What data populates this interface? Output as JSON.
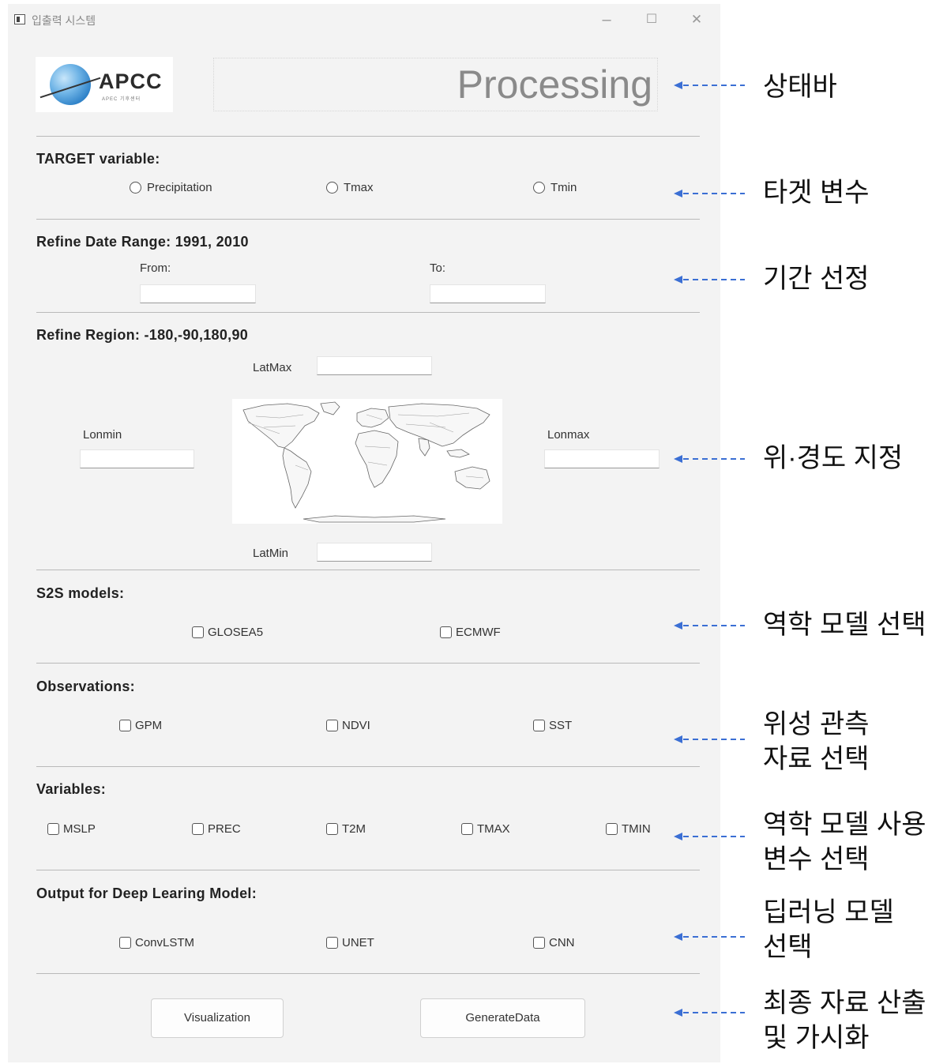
{
  "window": {
    "title": "입출력 시스템",
    "minimize_glyph": "–",
    "maximize_glyph": "☐",
    "close_glyph": "✕"
  },
  "logo": {
    "text": "APCC",
    "subtext": "APEC 기후센터"
  },
  "status_bar": {
    "text": "Processing"
  },
  "target_variable": {
    "title": "TARGET variable:",
    "options": [
      "Precipitation",
      "Tmax",
      "Tmin"
    ]
  },
  "date_range": {
    "title": "Refine Date Range: 1991, 2010",
    "from_label": "From:",
    "to_label": "To:",
    "from_value": "",
    "to_value": ""
  },
  "region": {
    "title": "Refine Region: -180,-90,180,90",
    "latmax_label": "LatMax",
    "latmin_label": "LatMin",
    "lonmin_label": "Lonmin",
    "lonmax_label": "Lonmax",
    "latmax_value": "",
    "latmin_value": "",
    "lonmin_value": "",
    "lonmax_value": ""
  },
  "s2s_models": {
    "title": "S2S models:",
    "options": [
      "GLOSEA5",
      "ECMWF"
    ]
  },
  "observations": {
    "title": "Observations:",
    "options": [
      "GPM",
      "NDVI",
      "SST"
    ]
  },
  "variables": {
    "title": "Variables:",
    "options": [
      "MSLP",
      "PREC",
      "T2M",
      "TMAX",
      "TMIN"
    ]
  },
  "output_model": {
    "title": "Output for Deep Learing Model:",
    "options": [
      "ConvLSTM",
      "UNET",
      "CNN"
    ]
  },
  "buttons": {
    "visualization": "Visualization",
    "generate": "GenerateData"
  },
  "annotations": [
    "상태바",
    "타겟 변수",
    "기간 선정",
    "위·경도 지정",
    "역학 모델 선택",
    "위성 관측\n자료 선택",
    "역학 모델 사용\n변수 선택",
    "딥러닝 모델\n선택",
    "최종 자료 산출\n및 가시화"
  ],
  "colors": {
    "arrow": "#3b6fd4",
    "window_bg": "#f3f3f3",
    "status_text": "#8a8a8a"
  }
}
